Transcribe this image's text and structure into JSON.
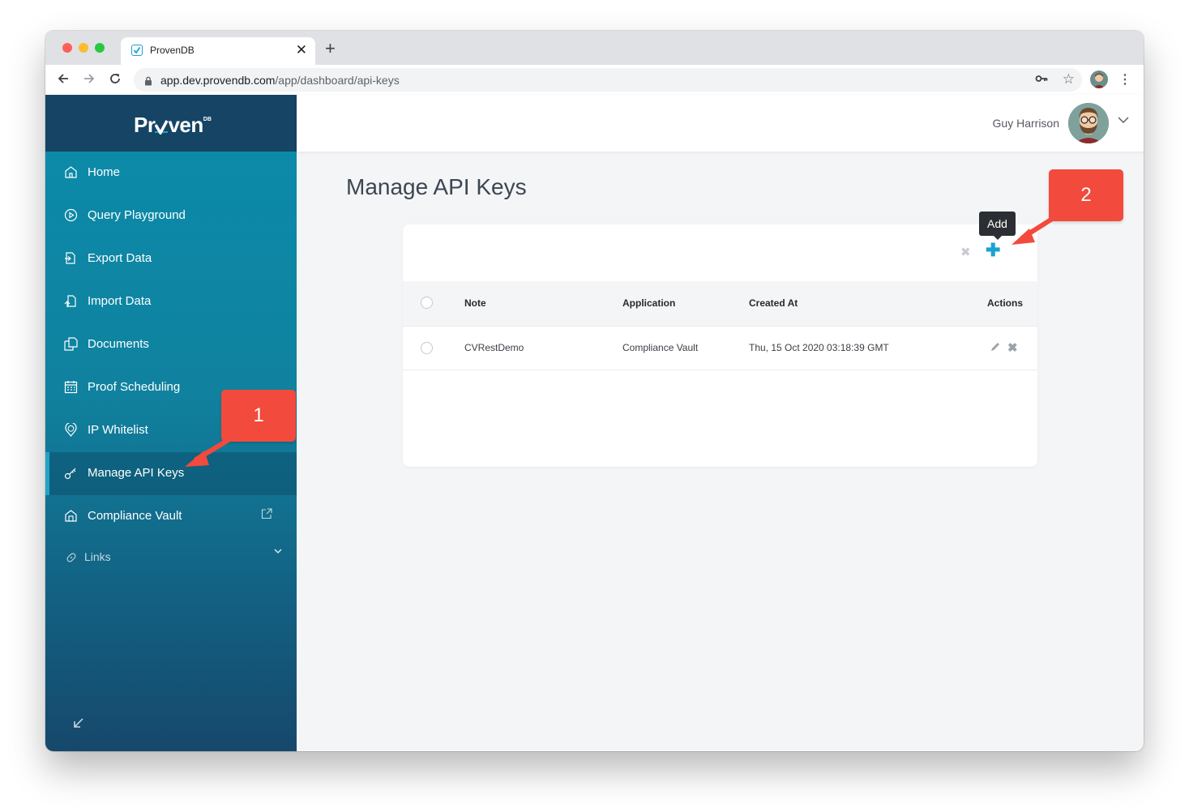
{
  "browser": {
    "tab_title": "ProvenDB",
    "close_glyph": "✕",
    "new_tab_glyph": "+",
    "url_host": "app.dev.provendb.com",
    "url_path": "/app/dashboard/api-keys"
  },
  "sidebar": {
    "logo_text": "Pr",
    "logo_text2": "ven",
    "logo_sup": "DB",
    "items": [
      {
        "label": "Home",
        "icon": "home-icon"
      },
      {
        "label": "Query Playground",
        "icon": "play-circle-icon"
      },
      {
        "label": "Export Data",
        "icon": "export-icon"
      },
      {
        "label": "Import Data",
        "icon": "import-icon"
      },
      {
        "label": "Documents",
        "icon": "documents-icon"
      },
      {
        "label": "Proof Scheduling",
        "icon": "calendar-icon"
      },
      {
        "label": "IP Whitelist",
        "icon": "ip-pin-icon"
      },
      {
        "label": "Manage API Keys",
        "icon": "key-icon",
        "active": true
      },
      {
        "label": "Compliance Vault",
        "icon": "vault-icon"
      }
    ],
    "links_label": "Links"
  },
  "header": {
    "user_name": "Guy Harrison"
  },
  "main": {
    "title": "Manage API Keys",
    "tooltip_add": "Add",
    "table": {
      "columns": [
        "Note",
        "Application",
        "Created At",
        "Actions"
      ],
      "rows": [
        {
          "note": "CVRestDemo",
          "application": "Compliance Vault",
          "created_at": "Thu, 15 Oct 2020 03:18:39 GMT"
        }
      ]
    }
  },
  "annotations": {
    "callout_1": "1",
    "callout_2": "2"
  },
  "colors": {
    "accent": "#1aa3d0",
    "sidebar_dark": "#154464",
    "callout": "#f24a3c"
  }
}
